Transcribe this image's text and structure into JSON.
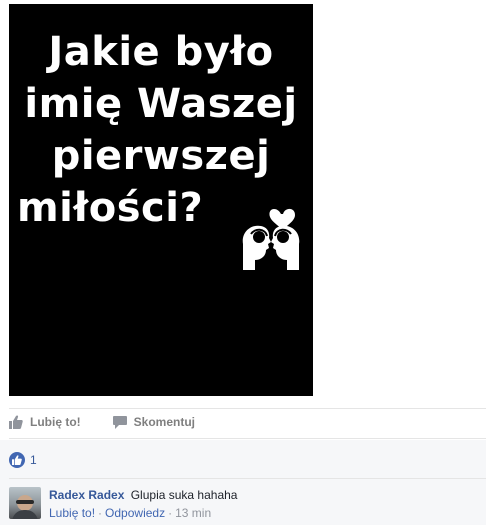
{
  "post_image": {
    "lines": [
      "Jakie było",
      "imię Waszej",
      "pierwszej",
      "miłości?"
    ],
    "emoji": "couple-kissing-heart-icon"
  },
  "actions": {
    "like_label": "Lubię to!",
    "comment_label": "Skomentuj"
  },
  "likes": {
    "count": "1"
  },
  "comments": [
    {
      "author": "Radex Radex",
      "text": "Glupia suka hahaha",
      "like_label": "Lubię to!",
      "reply_label": "Odpowiedz",
      "time": "13 min"
    }
  ],
  "colors": {
    "link": "#365899",
    "muted": "#90949c",
    "accent": "#4267b2"
  }
}
